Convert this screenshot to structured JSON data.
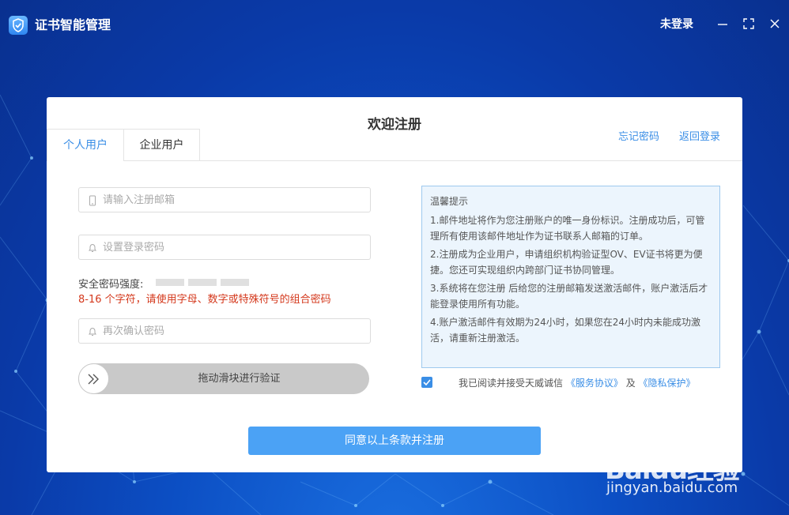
{
  "window": {
    "title": "证书智能管理",
    "login_status": "未登录",
    "controls": [
      "minimize-icon",
      "maximize-icon",
      "close-icon"
    ]
  },
  "card": {
    "title": "欢迎注册",
    "tabs": [
      {
        "label": "个人用户",
        "active": true
      },
      {
        "label": "企业用户",
        "active": false
      }
    ],
    "links": {
      "forgot_password": "忘记密码",
      "back_to_login": "返回登录"
    }
  },
  "form": {
    "email": {
      "placeholder": "请输入注册邮箱",
      "value": "",
      "icon": "phone-icon"
    },
    "password": {
      "placeholder": "设置登录密码",
      "value": "",
      "icon": "bell-icon"
    },
    "strength_label": "安全密码强度:",
    "password_hint": "8-16 个字符，请使用字母、数字或特殊符号的组合密码",
    "confirm": {
      "placeholder": "再次确认密码",
      "value": "",
      "icon": "bell-icon"
    },
    "slider_text": "拖动滑块进行验证",
    "submit_label": "同意以上条款并注册"
  },
  "tips": {
    "title": "温馨提示",
    "items": [
      "1.邮件地址将作为您注册账户的唯一身份标识。注册成功后，可管理所有使用该邮件地址作为证书联系人邮箱的订单。",
      "2.注册成为企业用户，申请组织机构验证型OV、EV证书将更为便捷。您还可实现组织内跨部门证书协同管理。",
      "3.系统将在您注册 后给您的注册邮箱发送激活邮件，账户激活后才能登录使用所有功能。",
      "4.账户激活邮件有效期为24小时，如果您在24小时内未能成功激活，请重新注册激活。"
    ]
  },
  "agreement": {
    "checked": true,
    "prefix": "我已阅读并接受天威诚信",
    "service_link": "《服务协议》",
    "and": "及",
    "privacy_link": "《隐私保护》"
  },
  "watermark": {
    "logo": "Baidu经验",
    "url": "jingyan.baidu.com"
  },
  "colors": {
    "accent": "#3a8ee6",
    "submit": "#4ba2f5",
    "hint_red": "#d4381c",
    "tips_bg": "#ecf5fd",
    "background": "#0c4fc4"
  }
}
